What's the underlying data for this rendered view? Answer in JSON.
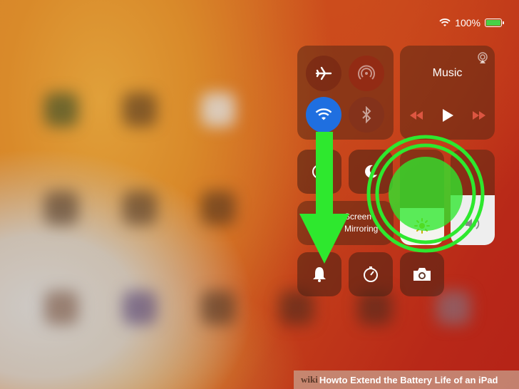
{
  "status_bar": {
    "wifi_icon": "wifi-icon",
    "battery_percent": "100%",
    "battery_level": 1.0,
    "battery_color": "#47d147"
  },
  "control_center": {
    "connectivity": {
      "airplane": {
        "icon": "airplane-icon",
        "state": "off"
      },
      "cellular": {
        "icon": "cellular-icon",
        "state": "off"
      },
      "wifi": {
        "icon": "wifi-icon",
        "state": "on",
        "color": "#1f6fe0"
      },
      "bluetooth": {
        "icon": "bluetooth-icon",
        "state": "off"
      }
    },
    "music": {
      "title": "Music",
      "airplay_icon": "airplay-icon",
      "prev_icon": "rewind-icon",
      "play_icon": "play-icon",
      "next_icon": "fast-forward-icon"
    },
    "rotation_lock": {
      "icon": "rotation-lock-icon"
    },
    "do_not_disturb": {
      "icon": "moon-icon"
    },
    "screen_mirroring": {
      "line1": "Screen",
      "line2": "Mirroring",
      "icon": "screen-mirroring-icon"
    },
    "brightness": {
      "icon": "sun-icon"
    },
    "volume": {
      "icon": "speaker-icon"
    },
    "bottom_row": [
      {
        "icon": "bell-icon"
      },
      {
        "icon": "timer-icon"
      },
      {
        "icon": "camera-icon"
      }
    ]
  },
  "annotation": {
    "arrow_color": "#2ee82e",
    "highlight_color": "#2ee82e"
  },
  "caption": {
    "wiki": "wiki",
    "how": "How",
    "rest": " to Extend the Battery Life of an iPad"
  }
}
